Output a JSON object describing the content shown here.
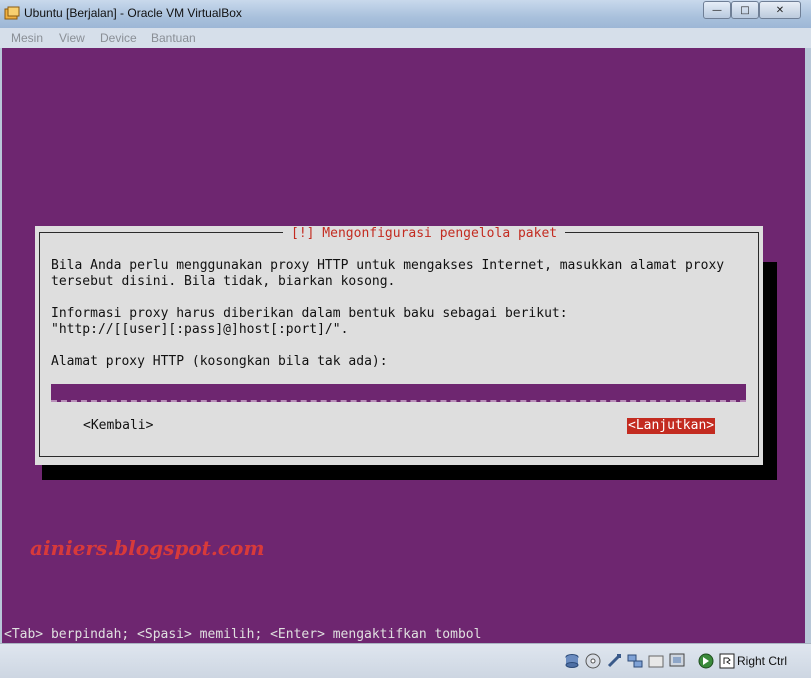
{
  "window": {
    "title": "Ubuntu [Berjalan] - Oracle VM VirtualBox",
    "minimize_glyph": "—",
    "maximize_glyph": "□",
    "close_glyph": "✕"
  },
  "menu": {
    "items": [
      "Mesin",
      "View",
      "Device",
      "Bantuan"
    ]
  },
  "dialog": {
    "title": "[!] Mengonfigurasi pengelola paket",
    "line1": "Bila Anda perlu menggunakan proxy HTTP untuk mengakses Internet, masukkan alamat proxy",
    "line2": "tersebut disini. Bila tidak, biarkan kosong.",
    "line3": "Informasi proxy harus diberikan dalam bentuk baku sebagai berikut:",
    "line4": "\"http://[[user][:pass]@]host[:port]/\".",
    "field_label": "Alamat proxy HTTP (kosongkan bila tak ada):",
    "field_value": "",
    "back_button": "<Kembali>",
    "next_button": "<Lanjutkan>"
  },
  "watermark": "ainiers.blogspot.com",
  "hint": "<Tab> berpindah; <Spasi> memilih; <Enter> mengaktifkan tombol",
  "statusbar": {
    "icons": [
      "hard-disk-icon",
      "optical-drive-icon",
      "usb-icon",
      "network-icon",
      "shared-folder-icon",
      "display-icon",
      "mouse-integration-icon",
      "keyboard-capture-icon"
    ],
    "host_key": "Right Ctrl"
  },
  "colors": {
    "guest_background": "#6e2670",
    "dialog_background": "#dedede",
    "accent_red": "#c32b20"
  }
}
